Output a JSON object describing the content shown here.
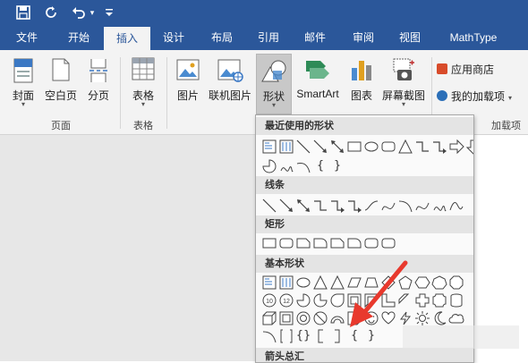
{
  "quick_access": {
    "save_icon": "save-icon",
    "undo_icon": "redo-icon",
    "undo2_icon": "undo-icon",
    "customize_icon": "customize-icon"
  },
  "tabs": [
    "文件",
    "开始",
    "插入",
    "设计",
    "布局",
    "引用",
    "邮件",
    "审阅",
    "视图",
    "MathType"
  ],
  "active_tab": "插入",
  "ribbon": {
    "pages_group": {
      "label": "页面",
      "buttons": [
        "封面",
        "空白页",
        "分页"
      ]
    },
    "tables_group": {
      "label": "表格",
      "buttons": [
        "表格"
      ]
    },
    "illustrations": {
      "buttons": [
        "图片",
        "联机图片",
        "形状",
        "SmartArt",
        "图表",
        "屏幕截图"
      ]
    },
    "addins": {
      "label": "加载项",
      "store": "应用商店",
      "my_addins": "我的加载项"
    }
  },
  "gallery": {
    "sections": [
      "最近使用的形状",
      "线条",
      "矩形",
      "基本形状",
      "箭头总汇"
    ]
  },
  "colors": {
    "accent": "#2b579a",
    "ribbon_bg": "#f3f3f3",
    "annotation_arrow": "#e8392d"
  }
}
